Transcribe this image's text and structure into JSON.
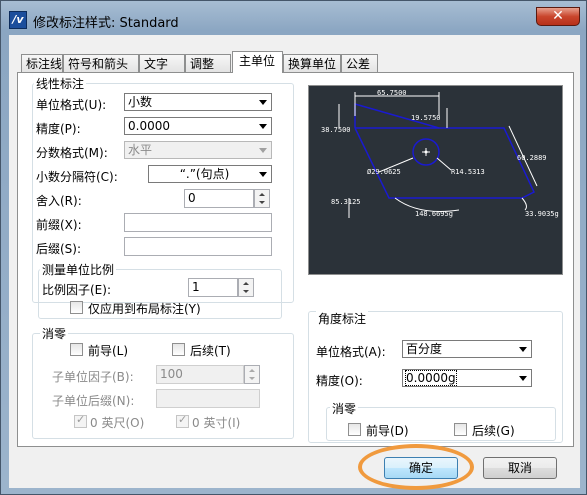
{
  "window": {
    "title": "修改标注样式: Standard",
    "close_glyph": "✕"
  },
  "tabs": [
    {
      "label": "标注线"
    },
    {
      "label": "符号和箭头"
    },
    {
      "label": "文字"
    },
    {
      "label": "调整"
    },
    {
      "label": "主单位",
      "active": true
    },
    {
      "label": "换算单位"
    },
    {
      "label": "公差"
    }
  ],
  "linear": {
    "title": "线性标注",
    "unit_format": {
      "label": "单位格式(U):",
      "value": "小数"
    },
    "precision": {
      "label": "精度(P):",
      "value": "0.0000"
    },
    "fraction_format": {
      "label": "分数格式(M):",
      "value": "水平"
    },
    "decimal_separator": {
      "label": "小数分隔符(C):",
      "value": "“.”(句点)"
    },
    "round_off": {
      "label": "舍入(R):",
      "value": "0"
    },
    "prefix": {
      "label": "前缀(X):",
      "value": ""
    },
    "suffix": {
      "label": "后缀(S):",
      "value": ""
    }
  },
  "measurement_scale": {
    "title": "测量单位比例",
    "scale_factor": {
      "label": "比例因子(E):",
      "value": "1"
    },
    "layout_only": {
      "label": "仅应用到布局标注(Y)",
      "checked": false
    }
  },
  "zero_suppression": {
    "title": "消零",
    "leading": {
      "label": "前导(L)",
      "checked": false
    },
    "trailing": {
      "label": "后续(T)",
      "checked": false
    },
    "sub_unit_factor": {
      "label": "子单位因子(B):",
      "value": "100"
    },
    "sub_unit_suffix": {
      "label": "子单位后缀(N):",
      "value": ""
    },
    "zero_feet": {
      "label": "0 英尺(O)",
      "checked": true
    },
    "zero_inches": {
      "label": "0 英寸(I)",
      "checked": true
    }
  },
  "preview": {
    "dims": [
      "65.7500",
      "38.7500",
      "19.5750",
      "60.2889",
      "R14.5313",
      "Ø29.0625",
      "85.3125",
      "148.6695g",
      "33.9035g"
    ],
    "colors": {
      "background": "#2b3239",
      "geometry": "#1a1ad0",
      "dimension": "#ffffff"
    }
  },
  "angular": {
    "title": "角度标注",
    "unit_format": {
      "label": "单位格式(A):",
      "value": "百分度"
    },
    "precision": {
      "label": "精度(O):",
      "value": "0.0000g"
    },
    "zero_title": "消零",
    "leading": {
      "label": "前导(D)",
      "checked": false
    },
    "trailing": {
      "label": "后续(G)",
      "checked": false
    }
  },
  "buttons": {
    "ok": "确定",
    "cancel": "取消"
  }
}
